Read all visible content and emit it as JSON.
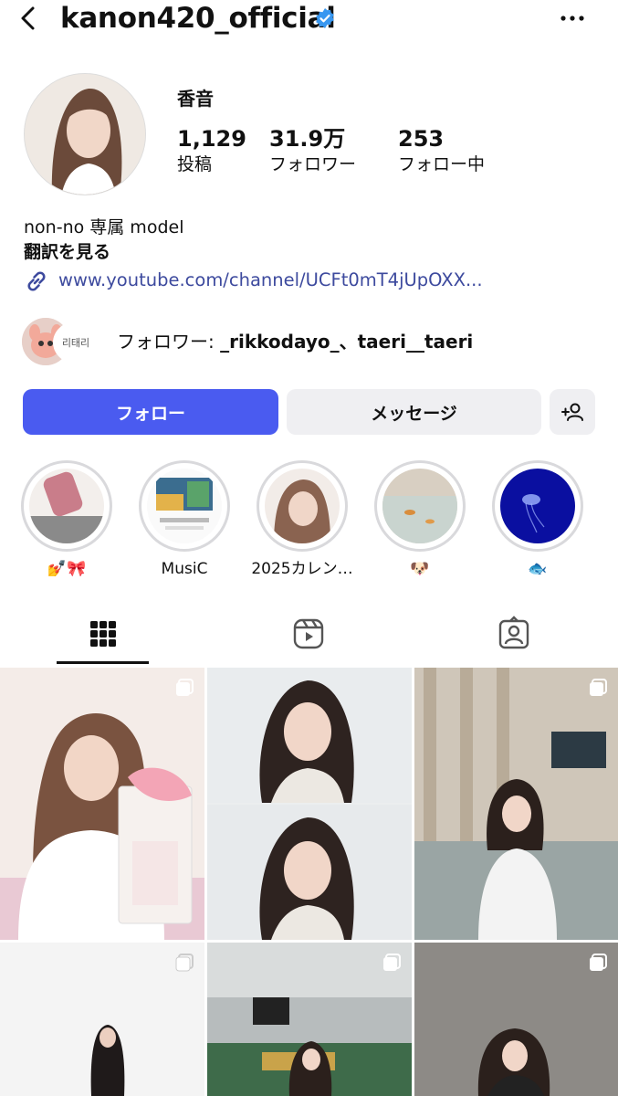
{
  "header": {
    "username": "kanon420_official",
    "verified_icon": "verified-badge-icon",
    "back_icon": "chevron-left-icon",
    "more_icon": "more-horizontal-icon"
  },
  "profile": {
    "display_name": "香音",
    "stats": [
      {
        "value": "1,129",
        "label": "投稿"
      },
      {
        "value": "31.9万",
        "label": "フォロワー"
      },
      {
        "value": "253",
        "label": "フォロー中"
      }
    ],
    "bio": "non-no 専属 model",
    "translate_label": "翻訳を見る",
    "link": "www.youtube.com/channel/UCFt0mT4jUpOXX...",
    "followed_by_prefix": "フォロワー: ",
    "followed_by_names": "_rikkodayo_、taeri__taeri",
    "mutual_badge": "리태리"
  },
  "actions": {
    "follow": "フォロー",
    "message": "メッセージ"
  },
  "highlights": [
    {
      "label": "💅🎀"
    },
    {
      "label": "MusiC"
    },
    {
      "label": "2025カレン…"
    },
    {
      "label": "🐶"
    },
    {
      "label": "🐟"
    }
  ],
  "tabs": [
    "grid-icon",
    "reels-icon",
    "tagged-icon"
  ],
  "colors": {
    "accent": "#4a5bf0",
    "link": "#3d4a9e",
    "verified": "#3897f0"
  }
}
